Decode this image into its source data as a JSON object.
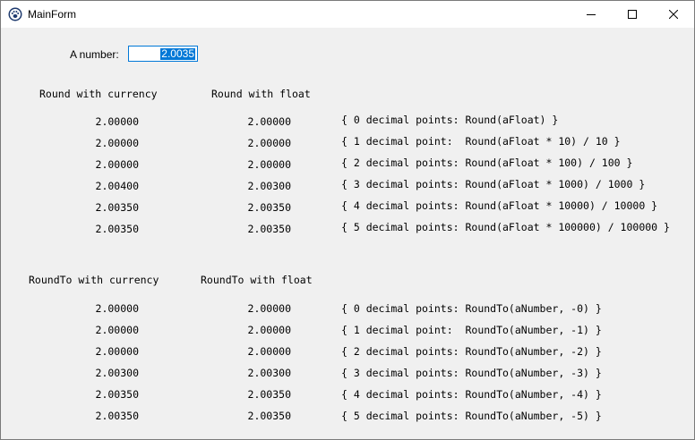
{
  "window": {
    "title": "MainForm",
    "icon": "paw-icon"
  },
  "controls": {
    "number_label": "A number:",
    "number_value": "2.0035"
  },
  "round_section": {
    "header_currency": "Round with currency",
    "header_float": "Round with float",
    "rows": [
      {
        "currency": "2.00000",
        "float": "2.00000",
        "comment": "{ 0 decimal points: Round(aFloat) }"
      },
      {
        "currency": "2.00000",
        "float": "2.00000",
        "comment": "{ 1 decimal point:  Round(aFloat * 10) / 10 }"
      },
      {
        "currency": "2.00000",
        "float": "2.00000",
        "comment": "{ 2 decimal points: Round(aFloat * 100) / 100 }"
      },
      {
        "currency": "2.00400",
        "float": "2.00300",
        "comment": "{ 3 decimal points: Round(aFloat * 1000) / 1000 }"
      },
      {
        "currency": "2.00350",
        "float": "2.00350",
        "comment": "{ 4 decimal points: Round(aFloat * 10000) / 10000 }"
      },
      {
        "currency": "2.00350",
        "float": "2.00350",
        "comment": "{ 5 decimal points: Round(aFloat * 100000) / 100000 }"
      }
    ]
  },
  "roundto_section": {
    "header_currency": "RoundTo with currency",
    "header_float": "RoundTo with float",
    "rows": [
      {
        "currency": "2.00000",
        "float": "2.00000",
        "comment": "{ 0 decimal points: RoundTo(aNumber, -0) }"
      },
      {
        "currency": "2.00000",
        "float": "2.00000",
        "comment": "{ 1 decimal point:  RoundTo(aNumber, -1) }"
      },
      {
        "currency": "2.00000",
        "float": "2.00000",
        "comment": "{ 2 decimal points: RoundTo(aNumber, -2) }"
      },
      {
        "currency": "2.00300",
        "float": "2.00300",
        "comment": "{ 3 decimal points: RoundTo(aNumber, -3) }"
      },
      {
        "currency": "2.00350",
        "float": "2.00350",
        "comment": "{ 4 decimal points: RoundTo(aNumber, -4) }"
      },
      {
        "currency": "2.00350",
        "float": "2.00350",
        "comment": "{ 5 decimal points: RoundTo(aNumber, -5) }"
      }
    ]
  }
}
